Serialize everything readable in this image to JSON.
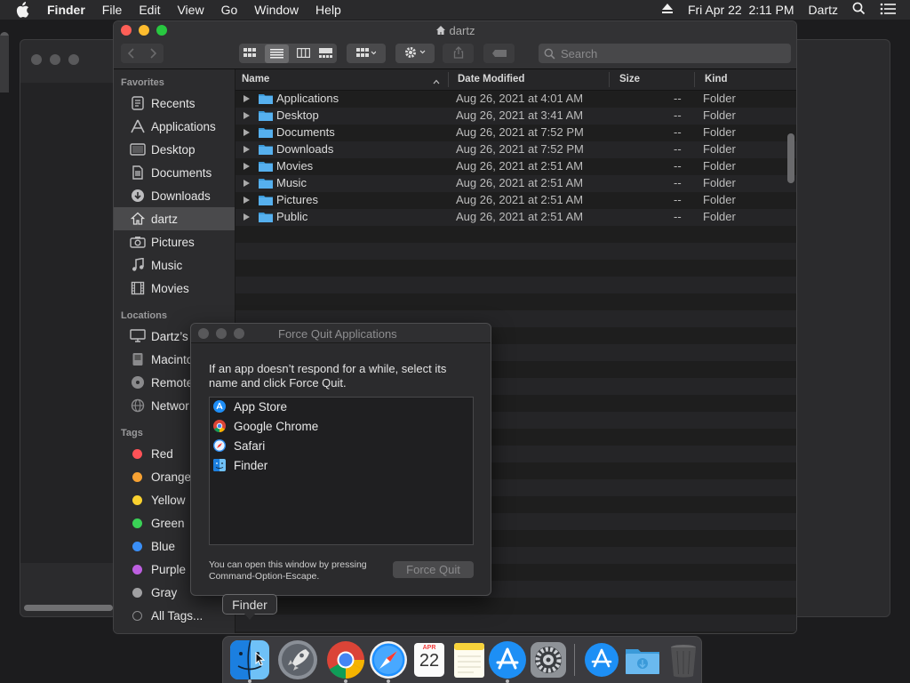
{
  "menubar": {
    "app_name": "Finder",
    "items": [
      "File",
      "Edit",
      "View",
      "Go",
      "Window",
      "Help"
    ],
    "clock": "Fri Apr 22  2:11 PM",
    "user": "Dartz"
  },
  "finder": {
    "title": "dartz",
    "search_placeholder": "Search",
    "sidebar": {
      "favorites_header": "Favorites",
      "favorites": [
        {
          "label": "Recents",
          "icon": "clock-icon"
        },
        {
          "label": "Applications",
          "icon": "applications-icon"
        },
        {
          "label": "Desktop",
          "icon": "desktop-icon"
        },
        {
          "label": "Documents",
          "icon": "document-icon"
        },
        {
          "label": "Downloads",
          "icon": "download-icon"
        },
        {
          "label": "dartz",
          "icon": "home-icon",
          "selected": true
        },
        {
          "label": "Pictures",
          "icon": "camera-icon"
        },
        {
          "label": "Music",
          "icon": "music-note-icon"
        },
        {
          "label": "Movies",
          "icon": "film-icon"
        }
      ],
      "locations_header": "Locations",
      "locations": [
        {
          "label": "Dartz’s",
          "icon": "computer-icon"
        },
        {
          "label": "Macinto",
          "icon": "disk-icon"
        },
        {
          "label": "Remote",
          "icon": "optical-disc-icon"
        },
        {
          "label": "Networ",
          "icon": "globe-icon"
        }
      ],
      "tags_header": "Tags",
      "tags": [
        {
          "label": "Red",
          "color": "#ff5257"
        },
        {
          "label": "Orange",
          "color": "#f7a233"
        },
        {
          "label": "Yellow",
          "color": "#f9d12f"
        },
        {
          "label": "Green",
          "color": "#3ad156"
        },
        {
          "label": "Blue",
          "color": "#3a8ff7"
        },
        {
          "label": "Purple",
          "color": "#bd5fe0"
        },
        {
          "label": "Gray",
          "color": "#a0a0a2"
        },
        {
          "label": "All Tags...",
          "color": ""
        }
      ]
    },
    "columns": {
      "name": "Name",
      "date": "Date Modified",
      "size": "Size",
      "kind": "Kind"
    },
    "rows": [
      {
        "name": "Applications",
        "date": "Aug 26, 2021 at 4:01 AM",
        "size": "--",
        "kind": "Folder"
      },
      {
        "name": "Desktop",
        "date": "Aug 26, 2021 at 3:41 AM",
        "size": "--",
        "kind": "Folder"
      },
      {
        "name": "Documents",
        "date": "Aug 26, 2021 at 7:52 PM",
        "size": "--",
        "kind": "Folder"
      },
      {
        "name": "Downloads",
        "date": "Aug 26, 2021 at 7:52 PM",
        "size": "--",
        "kind": "Folder"
      },
      {
        "name": "Movies",
        "date": "Aug 26, 2021 at 2:51 AM",
        "size": "--",
        "kind": "Folder"
      },
      {
        "name": "Music",
        "date": "Aug 26, 2021 at 2:51 AM",
        "size": "--",
        "kind": "Folder"
      },
      {
        "name": "Pictures",
        "date": "Aug 26, 2021 at 2:51 AM",
        "size": "--",
        "kind": "Folder"
      },
      {
        "name": "Public",
        "date": "Aug 26, 2021 at 2:51 AM",
        "size": "--",
        "kind": "Folder"
      }
    ]
  },
  "force_quit": {
    "title": "Force Quit Applications",
    "message": "If an app doesn’t respond for a while, select its name and click Force Quit.",
    "apps": [
      "App Store",
      "Google Chrome",
      "Safari",
      "Finder"
    ],
    "footer": "You can open this window by pressing Command-Option-Escape.",
    "button": "Force Quit"
  },
  "dock": {
    "tooltip": "Finder",
    "calendar_month": "APR",
    "calendar_day": "22"
  }
}
